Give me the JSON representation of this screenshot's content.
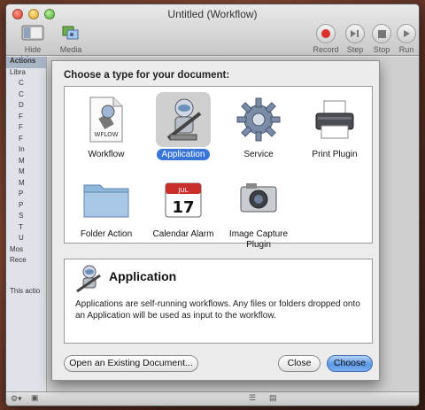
{
  "window": {
    "title": "Untitled (Workflow)"
  },
  "toolbar": {
    "hide_library": "Hide Library",
    "media": "Media",
    "record": "Record",
    "step": "Step",
    "stop": "Stop",
    "run": "Run"
  },
  "background": {
    "actions_tab": "Actions",
    "library_label": "Libra",
    "sidebar_rows": [
      "C",
      "C",
      "D",
      "F",
      "F",
      "F",
      "In",
      "M",
      "M",
      "M",
      "P",
      "P",
      "S",
      "T",
      "U"
    ],
    "most_used": "Mos",
    "recently_added": "Rece",
    "this_action": "This actio"
  },
  "sheet": {
    "heading": "Choose a type for your document:",
    "types": [
      {
        "label": "Workflow",
        "icon": "workflow-document-icon",
        "selected": false
      },
      {
        "label": "Application",
        "icon": "automator-robot-icon",
        "selected": true
      },
      {
        "label": "Service",
        "icon": "gear-icon",
        "selected": false
      },
      {
        "label": "Print Plugin",
        "icon": "printer-icon",
        "selected": false
      },
      {
        "label": "Folder Action",
        "icon": "folder-icon",
        "selected": false
      },
      {
        "label": "Calendar Alarm",
        "icon": "calendar-icon",
        "selected": false
      },
      {
        "label": "Image Capture Plugin",
        "icon": "camera-icon",
        "selected": false
      }
    ],
    "calendar_month": "JUL",
    "calendar_day": "17",
    "workflow_badge": "WFLOW",
    "description_title": "Application",
    "description_text": "Applications are self-running workflows. Any files or folders dropped onto an Application will be used as input to the workflow.",
    "buttons": {
      "open_existing": "Open an Existing Document...",
      "close": "Close",
      "choose": "Choose"
    }
  },
  "colors": {
    "selection_blue": "#3875d7",
    "default_button": "#5b98e6"
  }
}
